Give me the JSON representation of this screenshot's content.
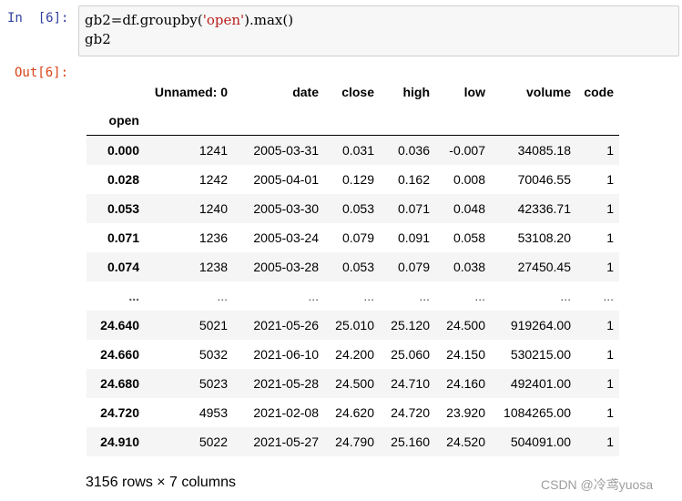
{
  "input_cell": {
    "prompt": "In  [6]:",
    "code_line1_pre": "gb2=df.groupby(",
    "code_line1_str": "'open'",
    "code_line1_post": ").max()",
    "code_line2": "gb2"
  },
  "output_cell": {
    "prompt": "Out[6]:",
    "table": {
      "columns": [
        "Unnamed: 0",
        "date",
        "close",
        "high",
        "low",
        "volume",
        "code"
      ],
      "index_name": "open",
      "rows": [
        {
          "index": "0.000",
          "values": [
            "1241",
            "2005-03-31",
            "0.031",
            "0.036",
            "-0.007",
            "34085.18",
            "1"
          ]
        },
        {
          "index": "0.028",
          "values": [
            "1242",
            "2005-04-01",
            "0.129",
            "0.162",
            "0.008",
            "70046.55",
            "1"
          ]
        },
        {
          "index": "0.053",
          "values": [
            "1240",
            "2005-03-30",
            "0.053",
            "0.071",
            "0.048",
            "42336.71",
            "1"
          ]
        },
        {
          "index": "0.071",
          "values": [
            "1236",
            "2005-03-24",
            "0.079",
            "0.091",
            "0.058",
            "53108.20",
            "1"
          ]
        },
        {
          "index": "0.074",
          "values": [
            "1238",
            "2005-03-28",
            "0.053",
            "0.079",
            "0.038",
            "27450.45",
            "1"
          ]
        },
        {
          "index": "...",
          "values": [
            "...",
            "...",
            "...",
            "...",
            "...",
            "...",
            "..."
          ]
        },
        {
          "index": "24.640",
          "values": [
            "5021",
            "2021-05-26",
            "25.010",
            "25.120",
            "24.500",
            "919264.00",
            "1"
          ]
        },
        {
          "index": "24.660",
          "values": [
            "5032",
            "2021-06-10",
            "24.200",
            "25.060",
            "24.150",
            "530215.00",
            "1"
          ]
        },
        {
          "index": "24.680",
          "values": [
            "5023",
            "2021-05-28",
            "24.500",
            "24.710",
            "24.160",
            "492401.00",
            "1"
          ]
        },
        {
          "index": "24.720",
          "values": [
            "4953",
            "2021-02-08",
            "24.620",
            "24.720",
            "23.920",
            "1084265.00",
            "1"
          ]
        },
        {
          "index": "24.910",
          "values": [
            "5022",
            "2021-05-27",
            "24.790",
            "25.160",
            "24.520",
            "504091.00",
            "1"
          ]
        }
      ]
    },
    "summary": "3156 rows × 7 columns"
  },
  "watermark": "CSDN @冷鸢yuosa"
}
